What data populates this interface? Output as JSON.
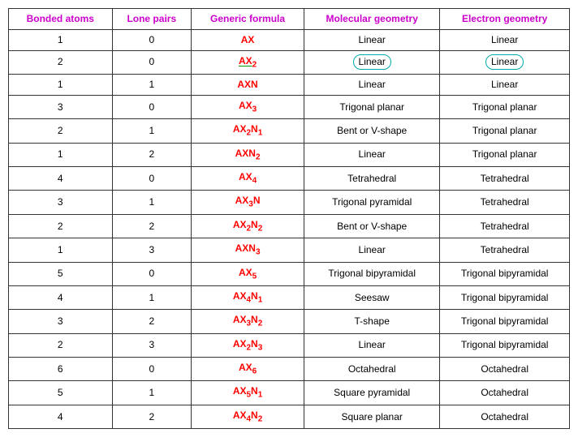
{
  "headers": [
    "Bonded atoms",
    "Lone pairs",
    "Generic formula",
    "Molecular geometry",
    "Electron geometry"
  ],
  "rows": [
    {
      "bonded": "1",
      "lone": "0",
      "formula_html": "AX",
      "mol_geo": "Linear",
      "elec_geo": "Linear",
      "mol_circled": false,
      "elec_circled": false,
      "formula_underline": false
    },
    {
      "bonded": "2",
      "lone": "0",
      "formula_html": "AX<sub>2</sub>",
      "mol_geo": "Linear",
      "elec_geo": "Linear",
      "mol_circled": true,
      "elec_circled": true,
      "formula_underline": true
    },
    {
      "bonded": "1",
      "lone": "1",
      "formula_html": "AXN",
      "mol_geo": "Linear",
      "elec_geo": "Linear",
      "mol_circled": false,
      "elec_circled": false,
      "formula_underline": false
    },
    {
      "bonded": "3",
      "lone": "0",
      "formula_html": "AX<sub>3</sub>",
      "mol_geo": "Trigonal planar",
      "elec_geo": "Trigonal planar",
      "mol_circled": false,
      "elec_circled": false,
      "formula_underline": false
    },
    {
      "bonded": "2",
      "lone": "1",
      "formula_html": "AX<sub>2</sub>N<sub>1</sub>",
      "mol_geo": "Bent or V-shape",
      "elec_geo": "Trigonal planar",
      "mol_circled": false,
      "elec_circled": false,
      "formula_underline": false
    },
    {
      "bonded": "1",
      "lone": "2",
      "formula_html": "AXN<sub>2</sub>",
      "mol_geo": "Linear",
      "elec_geo": "Trigonal planar",
      "mol_circled": false,
      "elec_circled": false,
      "formula_underline": false
    },
    {
      "bonded": "4",
      "lone": "0",
      "formula_html": "AX<sub>4</sub>",
      "mol_geo": "Tetrahedral",
      "elec_geo": "Tetrahedral",
      "mol_circled": false,
      "elec_circled": false,
      "formula_underline": false
    },
    {
      "bonded": "3",
      "lone": "1",
      "formula_html": "AX<sub>3</sub>N",
      "mol_geo": "Trigonal pyramidal",
      "elec_geo": "Tetrahedral",
      "mol_circled": false,
      "elec_circled": false,
      "formula_underline": false
    },
    {
      "bonded": "2",
      "lone": "2",
      "formula_html": "AX<sub>2</sub>N<sub>2</sub>",
      "mol_geo": "Bent or V-shape",
      "elec_geo": "Tetrahedral",
      "mol_circled": false,
      "elec_circled": false,
      "formula_underline": false
    },
    {
      "bonded": "1",
      "lone": "3",
      "formula_html": "AXN<sub>3</sub>",
      "mol_geo": "Linear",
      "elec_geo": "Tetrahedral",
      "mol_circled": false,
      "elec_circled": false,
      "formula_underline": false
    },
    {
      "bonded": "5",
      "lone": "0",
      "formula_html": "AX<sub>5</sub>",
      "mol_geo": "Trigonal bipyramidal",
      "elec_geo": "Trigonal bipyramidal",
      "mol_circled": false,
      "elec_circled": false,
      "formula_underline": false
    },
    {
      "bonded": "4",
      "lone": "1",
      "formula_html": "AX<sub>4</sub>N<sub>1</sub>",
      "mol_geo": "Seesaw",
      "elec_geo": "Trigonal bipyramidal",
      "mol_circled": false,
      "elec_circled": false,
      "formula_underline": false
    },
    {
      "bonded": "3",
      "lone": "2",
      "formula_html": "AX<sub>3</sub>N<sub>2</sub>",
      "mol_geo": "T-shape",
      "elec_geo": "Trigonal bipyramidal",
      "mol_circled": false,
      "elec_circled": false,
      "formula_underline": false
    },
    {
      "bonded": "2",
      "lone": "3",
      "formula_html": "AX<sub>2</sub>N<sub>3</sub>",
      "mol_geo": "Linear",
      "elec_geo": "Trigonal bipyramidal",
      "mol_circled": false,
      "elec_circled": false,
      "formula_underline": false
    },
    {
      "bonded": "6",
      "lone": "0",
      "formula_html": "AX<sub>6</sub>",
      "mol_geo": "Octahedral",
      "elec_geo": "Octahedral",
      "mol_circled": false,
      "elec_circled": false,
      "formula_underline": false
    },
    {
      "bonded": "5",
      "lone": "1",
      "formula_html": "AX<sub>5</sub>N<sub>1</sub>",
      "mol_geo": "Square pyramidal",
      "elec_geo": "Octahedral",
      "mol_circled": false,
      "elec_circled": false,
      "formula_underline": false
    },
    {
      "bonded": "4",
      "lone": "2",
      "formula_html": "AX<sub>4</sub>N<sub>2</sub>",
      "mol_geo": "Square planar",
      "elec_geo": "Octahedral",
      "mol_circled": false,
      "elec_circled": false,
      "formula_underline": false
    }
  ]
}
